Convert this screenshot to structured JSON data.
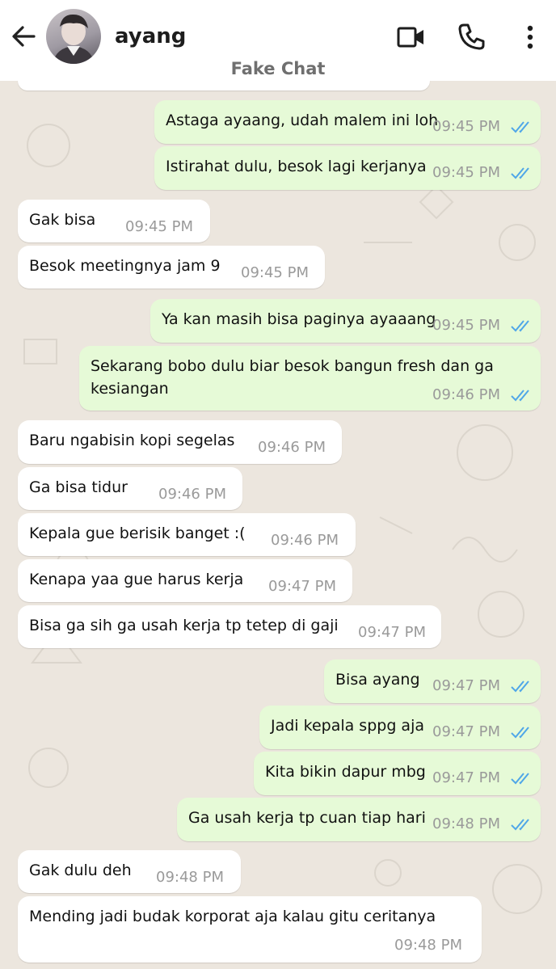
{
  "header": {
    "contact_name": "ayang",
    "subtitle": "Fake Chat",
    "icons": [
      "back-arrow-icon",
      "video-call-icon",
      "phone-icon",
      "more-vert-icon"
    ]
  },
  "colors": {
    "incoming_bubble": "#ffffff",
    "outgoing_bubble": "#e6fad7",
    "read_tick": "#4fa6e8",
    "chat_background": "#ece6de"
  },
  "messages": [
    {
      "text": "Astaga ayaang, udah malem ini loh",
      "time": "09:45 PM",
      "dir": "out",
      "status": "read"
    },
    {
      "text": "Istirahat dulu, besok lagi kerjanya",
      "time": "09:45 PM",
      "dir": "out",
      "status": "read"
    },
    {
      "text": "Gak bisa",
      "time": "09:45 PM",
      "dir": "in"
    },
    {
      "text": "Besok meetingnya jam 9",
      "time": "09:45 PM",
      "dir": "in"
    },
    {
      "text": "Ya kan masih bisa paginya ayaaang",
      "time": "09:45 PM",
      "dir": "out",
      "status": "read"
    },
    {
      "text": "Sekarang bobo dulu biar besok bangun fresh dan ga",
      "text2": "kesiangan",
      "time": "09:46 PM",
      "dir": "out",
      "status": "read"
    },
    {
      "text": "Baru ngabisin kopi segelas",
      "time": "09:46 PM",
      "dir": "in"
    },
    {
      "text": "Ga bisa tidur",
      "time": "09:46 PM",
      "dir": "in"
    },
    {
      "text": "Kepala gue berisik banget :(",
      "time": "09:46 PM",
      "dir": "in"
    },
    {
      "text": "Kenapa yaa gue harus kerja",
      "time": "09:47 PM",
      "dir": "in"
    },
    {
      "text": "Bisa ga sih ga usah kerja tp tetep di gaji",
      "time": "09:47 PM",
      "dir": "in"
    },
    {
      "text": "Bisa ayang",
      "time": "09:47 PM",
      "dir": "out",
      "status": "read"
    },
    {
      "text": "Jadi kepala sppg aja",
      "time": "09:47 PM",
      "dir": "out",
      "status": "read"
    },
    {
      "text": "Kita bikin dapur mbg",
      "time": "09:47 PM",
      "dir": "out",
      "status": "read"
    },
    {
      "text": "Ga usah kerja tp cuan tiap hari",
      "time": "09:48 PM",
      "dir": "out",
      "status": "read"
    },
    {
      "text": "Gak dulu deh",
      "time": "09:48 PM",
      "dir": "in"
    },
    {
      "text": "Mending jadi budak korporat aja kalau gitu ceritanya",
      "time": "09:48 PM",
      "dir": "in"
    }
  ]
}
